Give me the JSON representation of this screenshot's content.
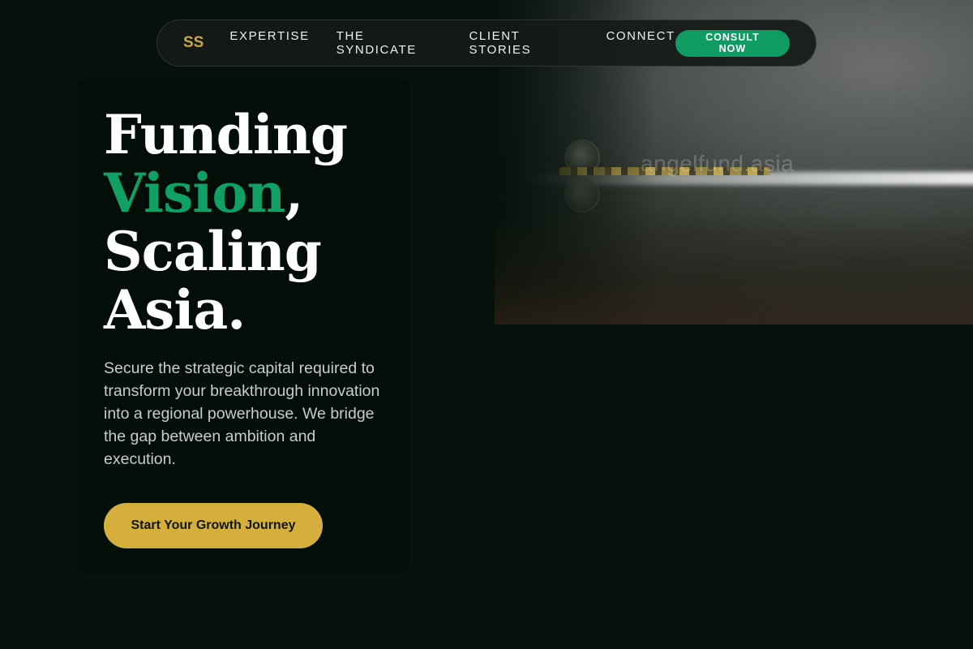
{
  "nav": {
    "logo": "SS",
    "links": [
      "EXPERTISE",
      "THE SYNDICATE",
      "CLIENT STORIES",
      "CONNECT"
    ],
    "cta_label": "CONSULT NOW"
  },
  "hero": {
    "headline_line1": "Funding",
    "headline_accent": "Vision",
    "headline_accent_punct": ",",
    "headline_line3": "Scaling",
    "headline_line4": "Asia.",
    "subtext": "Secure the strategic capital required to transform your breakthrough innovation into a regional powerhouse. We bridge the gap between ambition and execution.",
    "cta_label": "Start Your Growth Journey",
    "image_watermark": "angelfund.asia"
  },
  "colors": {
    "background": "#06110b",
    "accent_green": "#10a065",
    "accent_gold": "#d4af3c",
    "logo_gold": "#c9a947"
  }
}
